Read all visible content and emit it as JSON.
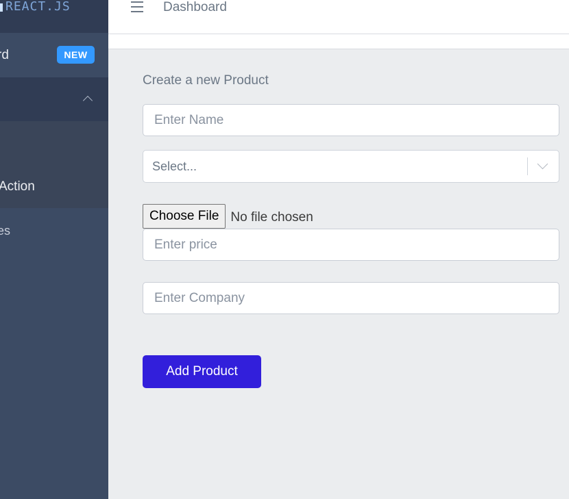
{
  "sidebar": {
    "brand": "REACT.JS",
    "items": [
      {
        "label": "rd",
        "badge": "NEW"
      },
      {
        "label": ""
      },
      {
        "label": "Action"
      },
      {
        "label": "es"
      }
    ]
  },
  "header": {
    "title": "Dashboard"
  },
  "form": {
    "title": "Create a new Product",
    "name_placeholder": "Enter Name",
    "select_value": "Select...",
    "file_button": "Choose File",
    "file_status": "No file chosen",
    "price_placeholder": "Enter price",
    "company_placeholder": "Enter Company",
    "submit_label": "Add Product"
  },
  "colors": {
    "sidebar": "#3c4b64",
    "accent": "#321fdb",
    "badge": "#3399ff"
  }
}
